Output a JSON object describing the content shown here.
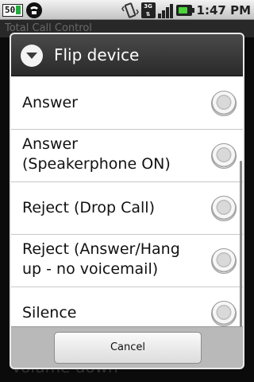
{
  "status_bar": {
    "badge": "50",
    "network": "3G",
    "time": "1:47 PM"
  },
  "background": {
    "app_title": "Total Call Control",
    "bottom_item": "Volume down"
  },
  "dialog": {
    "title": "Flip device",
    "options": [
      {
        "label": "Answer",
        "selected": false
      },
      {
        "label": "Answer\n(Speakerphone ON)",
        "selected": false
      },
      {
        "label": "Reject (Drop Call)",
        "selected": false
      },
      {
        "label": "Reject (Answer/Hang\nup - no voicemail)",
        "selected": false
      },
      {
        "label": "Silence",
        "selected": false
      }
    ],
    "cancel_label": "Cancel"
  }
}
